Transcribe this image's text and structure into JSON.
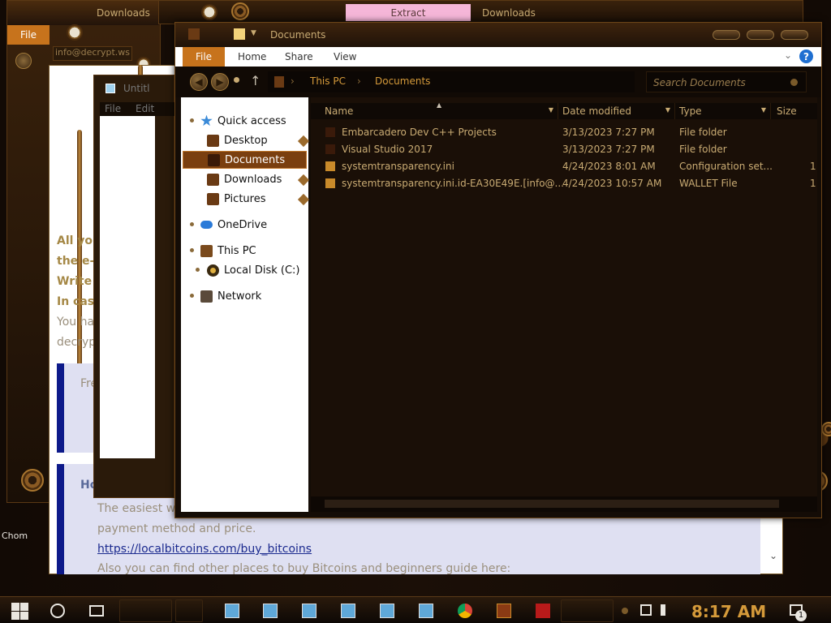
{
  "background_windows": {
    "downloads_title_left": "Downloads",
    "downloads_title_top": "Downloads",
    "extract_tab": "Extract",
    "file_menu": "File",
    "email_field": "info@decrypt.ws",
    "notepad_title": "Untitl",
    "notepad_menu_file": "File",
    "notepad_menu_edit": "Edit"
  },
  "ransom_note": {
    "line1": "All yo",
    "line2": "the e-",
    "line3": "Write",
    "line4": "In cas",
    "line5": "You ha",
    "line6": "decryp",
    "panel1_text": "Fre",
    "panel2_heading": "How",
    "panel2_line1": "The easiest wa",
    "panel2_line2": "payment method and price.",
    "link": "https://localbitcoins.com/buy_bitcoins",
    "panel2_line3": "Also you can find other places to buy Bitcoins and beginners guide here:"
  },
  "explorer": {
    "title": "Documents",
    "ribbon": {
      "file": "File",
      "tabs": [
        "Home",
        "Share",
        "View"
      ],
      "help": "?"
    },
    "address": {
      "crumbs": [
        "This PC",
        "Documents"
      ],
      "search_placeholder": "Search Documents"
    },
    "nav": {
      "quick_access": "Quick access",
      "desktop": "Desktop",
      "documents": "Documents",
      "downloads": "Downloads",
      "pictures": "Pictures",
      "onedrive": "OneDrive",
      "this_pc": "This PC",
      "local_disk": "Local Disk (C:)",
      "network": "Network"
    },
    "columns": {
      "name": "Name",
      "date": "Date modified",
      "type": "Type",
      "size": "Size"
    },
    "files": [
      {
        "name": "Embarcadero Dev C++ Projects",
        "date": "3/13/2023 7:27 PM",
        "type": "File folder",
        "size": "",
        "kind": "folder"
      },
      {
        "name": "Visual Studio 2017",
        "date": "3/13/2023 7:27 PM",
        "type": "File folder",
        "size": "",
        "kind": "folder"
      },
      {
        "name": "systemtransparency.ini",
        "date": "4/24/2023 8:01 AM",
        "type": "Configuration set...",
        "size": "1",
        "kind": "file"
      },
      {
        "name": "systemtransparency.ini.id-EA30E49E.[info@...",
        "date": "4/24/2023 10:57 AM",
        "type": "WALLET File",
        "size": "1",
        "kind": "file"
      }
    ]
  },
  "desktop": {
    "icon_label": "Chom"
  },
  "taskbar": {
    "clock": "8:17 AM",
    "notification_count": "1"
  },
  "colors": {
    "accent": "#c7731c",
    "crumb": "#d59a3a",
    "selected_nav": "#7a3f0f",
    "pink_tab": "#f5b6d8",
    "link": "#1b2a8f"
  }
}
